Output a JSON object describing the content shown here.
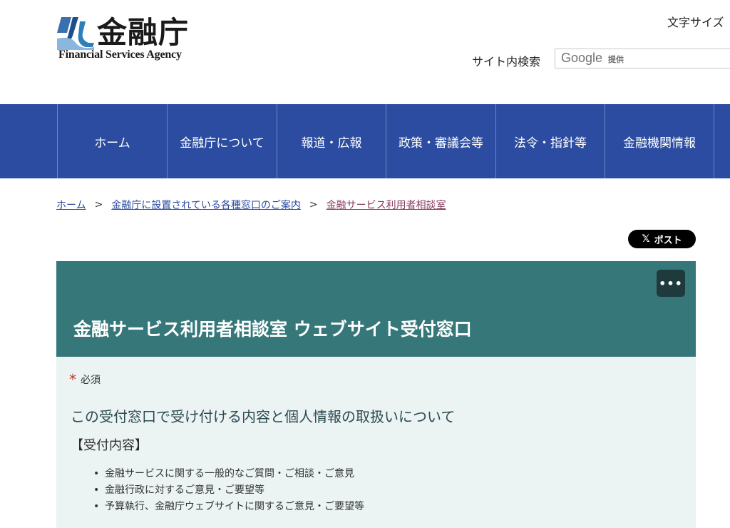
{
  "header": {
    "logo_kanji": "金融庁",
    "logo_english": "Financial Services Agency",
    "font_size_label": "文字サイズ",
    "search_label": "サイト内検索",
    "search_google": "Google",
    "search_provided": "提供"
  },
  "nav": {
    "items": [
      {
        "label": "ホーム"
      },
      {
        "label": "金融庁について"
      },
      {
        "label": "報道・広報"
      },
      {
        "label": "政策・審議会等"
      },
      {
        "label": "法令・指針等"
      },
      {
        "label": "金融機関情報"
      }
    ]
  },
  "breadcrumb": {
    "items": [
      {
        "label": "ホーム"
      },
      {
        "label": "金融庁に設置されている各種窓口のご案内"
      },
      {
        "label": "金融サービス利用者相談室"
      }
    ],
    "separator": ">"
  },
  "share": {
    "x_label": "ポスト",
    "x_glyph": "𝕏"
  },
  "form": {
    "title": "金融サービス利用者相談室 ウェブサイト受付窓口",
    "more_label": "•••",
    "required_mark": "*",
    "required_label": "必須",
    "section_title": "この受付窓口で受け付ける内容と個人情報の取扱いについて",
    "subhead": "【受付内容】",
    "bullets": [
      "金融サービスに関する一般的なご質問・ご相談・ご意見",
      "金融行政に対するご意見・ご要望等",
      "予算執行、金融庁ウェブサイトに関するご意見・ご要望等"
    ]
  },
  "colors": {
    "nav_bg": "#2b4ca0",
    "panel_header": "#36787a",
    "panel_body": "#ebf3f3",
    "link": "#2b4ca0"
  }
}
